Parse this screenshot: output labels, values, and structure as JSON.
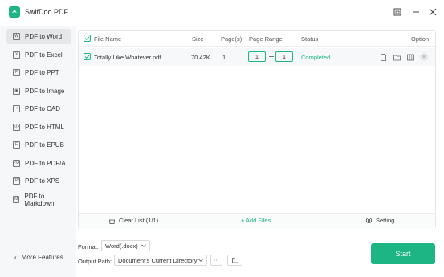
{
  "app": {
    "title": "SwifDoo PDF"
  },
  "sidebar": {
    "items": [
      {
        "icon": "W",
        "label": "PDF to Word",
        "active": true
      },
      {
        "icon": "X",
        "label": "PDF to Excel"
      },
      {
        "icon": "P",
        "label": "PDF to PPT"
      },
      {
        "icon": "▣",
        "label": "PDF to Image"
      },
      {
        "icon": "⇥",
        "label": "PDF to CAD"
      },
      {
        "icon": "</>",
        "label": "PDF to HTML"
      },
      {
        "icon": "E",
        "label": "PDF to EPUB"
      },
      {
        "icon": "P/A",
        "label": "PDF to PDF/A"
      },
      {
        "icon": "XPS",
        "label": "PDF to XPS"
      },
      {
        "icon": "M",
        "label": "PDF to Markdown"
      }
    ],
    "more_label": "More Features"
  },
  "table": {
    "headers": {
      "file_name": "File Name",
      "size": "Size",
      "pages": "Page(s)",
      "page_range": "Page Range",
      "status": "Status",
      "option": "Option"
    },
    "rows": [
      {
        "file_name": "Totally Like Whatever.pdf",
        "size": "70.42K",
        "pages": "1",
        "range_from": "1",
        "range_to": "1",
        "status": "Completed"
      }
    ]
  },
  "footer_actions": {
    "clear": "Clear List (1/1)",
    "add": "+ Add Files",
    "setting": "Setting"
  },
  "format": {
    "label": "Format:",
    "value": "Word(.docx)"
  },
  "output": {
    "label": "Output Path:",
    "value": "Document's Current Directory",
    "more": "···"
  },
  "start_label": "Start",
  "colors": {
    "accent": "#1db584"
  }
}
